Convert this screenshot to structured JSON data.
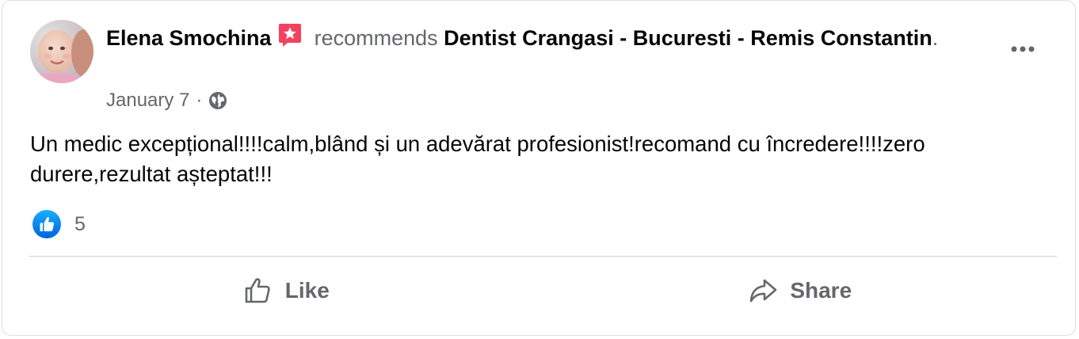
{
  "post": {
    "author": "Elena Smochina",
    "verb": "recommends",
    "page": "Dentist Crangasi - Bucuresti - Remis Constantin",
    "period": ".",
    "date": "January 7",
    "date_separator": "·",
    "audience_icon": "globe-icon",
    "badge_icon": "recommend-star-badge-icon",
    "body": "Un medic excepțional!!!!calm,blând și un adevărat profesionist!recomand cu încredere!!!!zero durere,rezultat așteptat!!!",
    "reaction_icon": "like-reaction-icon",
    "reaction_count": "5"
  },
  "actions": {
    "like_label": "Like",
    "share_label": "Share"
  },
  "colors": {
    "badge": "#f3425f",
    "like_blue": "#1877f2",
    "secondary_text": "#65676b",
    "divider": "#ced0d4"
  }
}
